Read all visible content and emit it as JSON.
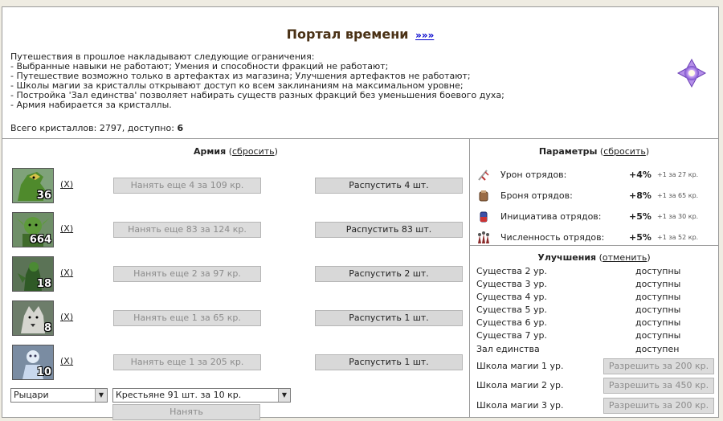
{
  "header": {
    "title": "Портал времени",
    "more_link": "»»»"
  },
  "intro_lines": [
    "Путешествия в прошлое накладывают следующие ограничения:",
    "- Выбранные навыки не работают; Умения и способности фракций не работают;",
    "- Путешествие возможно только в артефактах из магазина; Улучшения артефактов не работают;",
    "- Школы магии за кристаллы открывают доступ ко всем заклинаниям на максимальном уровне;",
    "- Постройка 'Зал единства' позволяет набирать существ разных фракций без уменьшения боевого духа;",
    "- Армия набирается за кристаллы."
  ],
  "crystals": {
    "label": "Всего кристаллов: 2797, доступно:",
    "available": "6"
  },
  "army": {
    "title": "Армия",
    "reset_open": " (",
    "reset_link": "сбросить",
    "reset_close": ")",
    "units": [
      {
        "count": "36",
        "remove": "(X)",
        "hire_label": "Нанять еще 4 за 109 кр.",
        "dismiss_label": "Распустить 4 шт."
      },
      {
        "count": "664",
        "remove": "(X)",
        "hire_label": "Нанять еще 83 за 124 кр.",
        "dismiss_label": "Распустить 83 шт."
      },
      {
        "count": "18",
        "remove": "(X)",
        "hire_label": "Нанять еще 2 за 97 кр.",
        "dismiss_label": "Распустить 2 шт."
      },
      {
        "count": "8",
        "remove": "(X)",
        "hire_label": "Нанять еще 1 за 65 кр.",
        "dismiss_label": "Распустить 1 шт."
      },
      {
        "count": "10",
        "remove": "(X)",
        "hire_label": "Нанять еще 1 за 205 кр.",
        "dismiss_label": "Распустить 1 шт."
      }
    ],
    "faction_select": "Рыцари",
    "creature_select": "Крестьяне 91 шт. за 10 кр.",
    "hire_button": "Нанять"
  },
  "params": {
    "title": "Параметры",
    "reset_open": " (",
    "reset_link": "сбросить",
    "reset_close": ")",
    "rows": [
      {
        "icon": "sword-icon",
        "label": "Урон отрядов:",
        "value": "+4%",
        "cost": "+1 за 27 кр."
      },
      {
        "icon": "armor-icon",
        "label": "Броня отрядов:",
        "value": "+8%",
        "cost": "+1 за 65 кр."
      },
      {
        "icon": "initiative-icon",
        "label": "Инициатива отрядов:",
        "value": "+5%",
        "cost": "+1 за 30 кр."
      },
      {
        "icon": "troops-icon",
        "label": "Численность отрядов:",
        "value": "+5%",
        "cost": "+1 за 52 кр."
      }
    ]
  },
  "upgrades": {
    "title": "Улучшения",
    "cancel_open": " (",
    "cancel_link": "отменить",
    "cancel_close": ")",
    "rows": [
      {
        "label": "Существа 2 ур.",
        "status": "доступны"
      },
      {
        "label": "Существа 3 ур.",
        "status": "доступны"
      },
      {
        "label": "Существа 4 ур.",
        "status": "доступны"
      },
      {
        "label": "Существа 5 ур.",
        "status": "доступны"
      },
      {
        "label": "Существа 6 ур.",
        "status": "доступны"
      },
      {
        "label": "Существа 7 ур.",
        "status": "доступны"
      },
      {
        "label": "Зал единства",
        "status": "доступен"
      }
    ],
    "schools": [
      {
        "label": "Школа магии 1 ур.",
        "button": "Разрешить за 200 кр."
      },
      {
        "label": "Школа магии 2 ур.",
        "button": "Разрешить за 450 кр."
      },
      {
        "label": "Школа магии 3 ур.",
        "button": "Разрешить за 200 кр."
      }
    ]
  },
  "colors": {
    "title": "#4a3115",
    "link": "#0000cc",
    "border": "#9b9b9b",
    "page_bg": "#efece2"
  }
}
